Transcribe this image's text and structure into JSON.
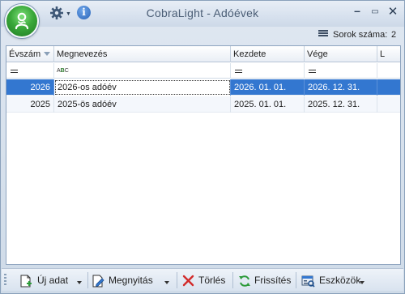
{
  "window": {
    "title": "CobraLight - Adóévek",
    "info_glyph": "i",
    "controls": {
      "minimize": "–",
      "maximize": "▭",
      "close": "✕"
    }
  },
  "status": {
    "rows_label": "Sorok száma:",
    "rows_count": "2"
  },
  "grid": {
    "columns": [
      "Évszám",
      "Megnevezés",
      "Kezdete",
      "Vége",
      "L"
    ],
    "filter_abc": {
      "a": "A",
      "b": "B",
      "c": "C"
    },
    "rows": [
      {
        "year": "2026",
        "name": "2026-os adóév",
        "start": "2026. 01. 01.",
        "end": "2026. 12. 31.",
        "selected": true
      },
      {
        "year": "2025",
        "name": "2025-ös adóév",
        "start": "2025. 01. 01.",
        "end": "2025. 12. 31.",
        "selected": false
      }
    ]
  },
  "toolbar": {
    "new_label": "Új adat",
    "open_label": "Megnyitás",
    "delete_label": "Törlés",
    "refresh_label": "Frissítés",
    "tools_label": "Eszközök"
  },
  "colors": {
    "selection": "#3377d0",
    "accent_green": "#3aa83a",
    "delete_red": "#d22b2b",
    "refresh_green": "#2d9b3a"
  },
  "icons": [
    "app-orb-icon",
    "gear-icon",
    "info-icon",
    "rows-icon",
    "filter-equals-icon",
    "filter-abc-icon",
    "new-document-icon",
    "open-edit-icon",
    "delete-x-icon",
    "refresh-icon",
    "tools-icon"
  ]
}
